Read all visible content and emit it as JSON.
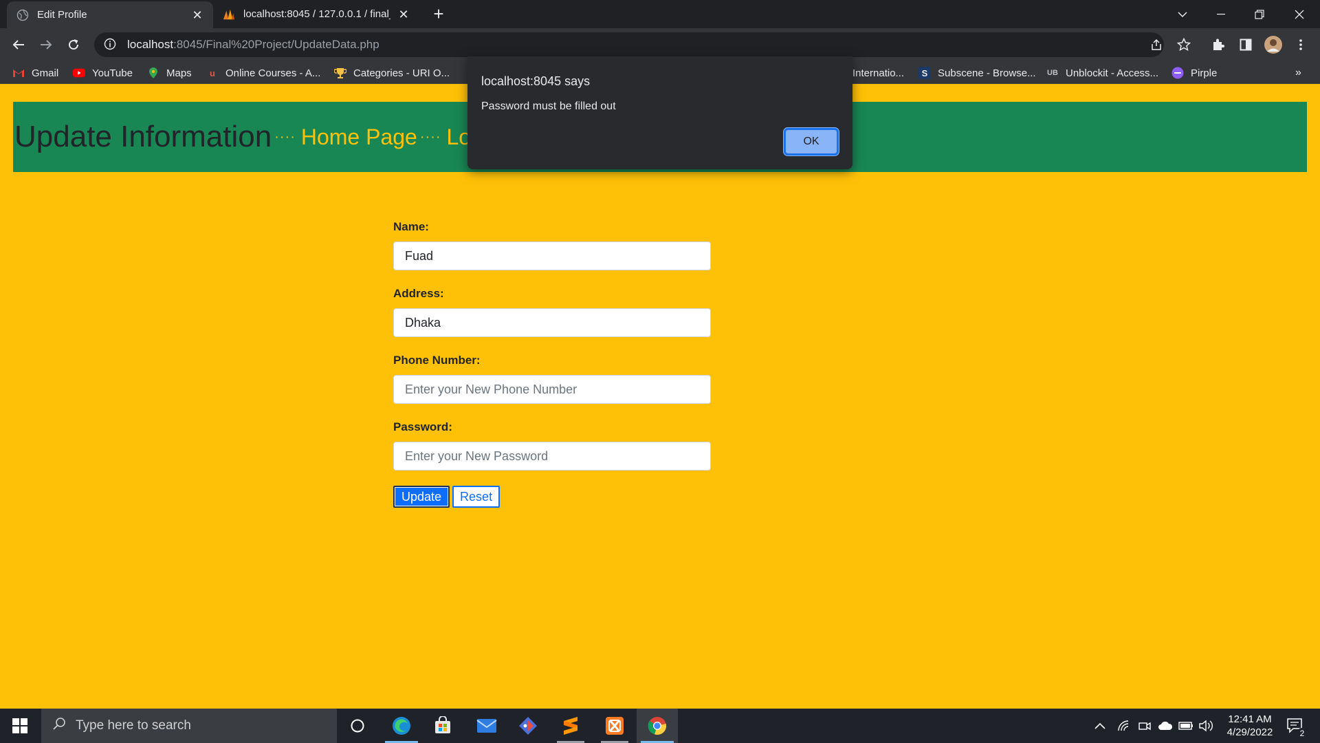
{
  "tabs": [
    {
      "title": "Edit Profile",
      "active": true
    },
    {
      "title": "localhost:8045 / 127.0.0.1 / final_",
      "active": false
    }
  ],
  "address_bar": {
    "host": "localhost",
    "path": ":8045/Final%20Project/UpdateData.php"
  },
  "bookmarks": [
    {
      "label": "Gmail",
      "icon": "gmail-icon"
    },
    {
      "label": "YouTube",
      "icon": "youtube-icon"
    },
    {
      "label": "Maps",
      "icon": "maps-icon"
    },
    {
      "label": "Online Courses - A...",
      "icon": "courses-icon"
    },
    {
      "label": "Categories - URI O...",
      "icon": "trophy-icon"
    },
    {
      "label": "Internatio...",
      "icon": "site-icon"
    },
    {
      "label": "Subscene - Browse...",
      "icon": "subscene-icon"
    },
    {
      "label": "Unblockit - Access...",
      "icon": "unblockit-icon"
    },
    {
      "label": "Pirple",
      "icon": "pirple-icon"
    }
  ],
  "header": {
    "title": "Update Information",
    "separator": "····",
    "home_link": "Home Page",
    "logout_link": "Lo"
  },
  "form": {
    "name_label": "Name:",
    "name_value": "Fuad",
    "address_label": "Address:",
    "address_value": "Dhaka",
    "phone_label": "Phone Number:",
    "phone_placeholder": "Enter your New Phone Number",
    "password_label": "Password:",
    "password_placeholder": "Enter your New Password",
    "update_button": "Update",
    "reset_button": "Reset"
  },
  "dialog": {
    "title": "localhost:8045 says",
    "message": "Password must be filled out",
    "ok_button": "OK"
  },
  "taskbar": {
    "search_placeholder": "Type here to search",
    "time": "12:41 AM",
    "date": "4/29/2022",
    "notification_count": "2"
  },
  "colors": {
    "page_bg": "#ffc107",
    "header_bg": "#198754",
    "primary": "#0d6efd"
  }
}
